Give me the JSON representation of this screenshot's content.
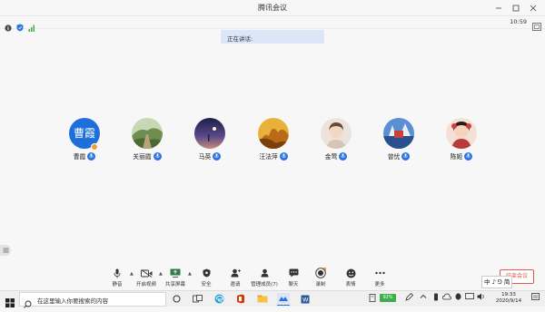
{
  "window": {
    "title": "腾讯会议"
  },
  "infobar": {
    "time": "10:59"
  },
  "speaking": {
    "label": "正在讲话:"
  },
  "participants": [
    {
      "name": "曹霞",
      "avatar_text": "曹霞",
      "avatar_color": "#1e6fd9",
      "host": true
    },
    {
      "name": "关丽霞",
      "avatar_text": "",
      "avatar_color": "#6f8d4f"
    },
    {
      "name": "马英",
      "avatar_text": "",
      "avatar_color": "#3b3f7a"
    },
    {
      "name": "汪法萍",
      "avatar_text": "",
      "avatar_color": "#c98a24"
    },
    {
      "name": "金莺",
      "avatar_text": "",
      "avatar_color": "#d9c8b8"
    },
    {
      "name": "曾忧",
      "avatar_text": "",
      "avatar_color": "#2a4f8f"
    },
    {
      "name": "陈姬",
      "avatar_text": "",
      "avatar_color": "#b83a3a"
    }
  ],
  "toolbar": {
    "items": [
      {
        "label": "静音",
        "icon": "mic-icon"
      },
      {
        "label": "开启视频",
        "icon": "video-icon"
      },
      {
        "label": "共享屏幕",
        "icon": "share-screen-icon"
      },
      {
        "label": "安全",
        "icon": "shield-icon"
      },
      {
        "label": "邀请",
        "icon": "invite-icon"
      },
      {
        "label": "管理成员(7)",
        "icon": "members-icon"
      },
      {
        "label": "聊天",
        "icon": "chat-icon"
      },
      {
        "label": "录制",
        "icon": "record-icon"
      },
      {
        "label": "表情",
        "icon": "emoji-icon"
      },
      {
        "label": "更多",
        "icon": "more-icon"
      }
    ],
    "end_label": "结束会议"
  },
  "taskbar": {
    "search_placeholder": "在这里输入你要搜索的内容",
    "battery": "92%",
    "ime": "中 ♪ ⅁ 简",
    "time": "19:33",
    "date": "2020/9/14"
  },
  "colors": {
    "accent": "#2b74e0",
    "end": "#e25a4f",
    "speaking_bg": "#dbe7f8"
  }
}
